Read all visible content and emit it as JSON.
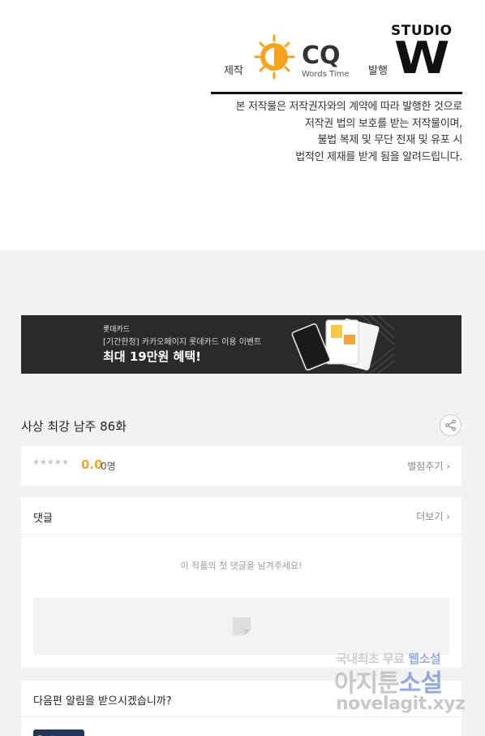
{
  "credits": {
    "made_by_label": "제작",
    "publisher_label": "발행",
    "producer_logo_text": "CQ",
    "producer_logo_sub": "Words Time",
    "publisher_logo_top": "STUDIO",
    "publisher_logo_main": "W"
  },
  "copyright_notice": [
    "본 저작물은 저작권자와의 계약에 따라 발행한 것으로",
    "저작권 법의 보호를 받는 저작물이며,",
    "불법 복제 및 무단 전재 및 유포 시",
    "법적인 제재를 받게 됨을 알려드립니다."
  ],
  "banner": {
    "brand": "롯데카드",
    "subtitle": "[기간한정] 카카오페이지 롯데카드 이용 이벤트",
    "headline": "최대 19만원 혜택!",
    "colors": {
      "background": "#2a2a2a",
      "text": "#ffffff"
    }
  },
  "episode": {
    "title": "사상 최강 남주 86화",
    "share_icon": "share-icon"
  },
  "rating": {
    "stars": "★★★★★",
    "score": "0.0",
    "count": "0명",
    "rate_link": "별점주기 ›",
    "accent_color": "#f5a623"
  },
  "comments": {
    "title": "댓글",
    "more_link": "더보기 ›",
    "empty_message": "이 작품의 첫 댓글을 남겨주세요!"
  },
  "notify": {
    "title": "다음편 알림을 받으시겠습니까?"
  },
  "watermark": {
    "line1_a": "국내최초 무료 ",
    "line1_b": "웹소설",
    "line2_a": "아지툰",
    "line2_b": "소설",
    "line3": "novelagit.xyz"
  }
}
